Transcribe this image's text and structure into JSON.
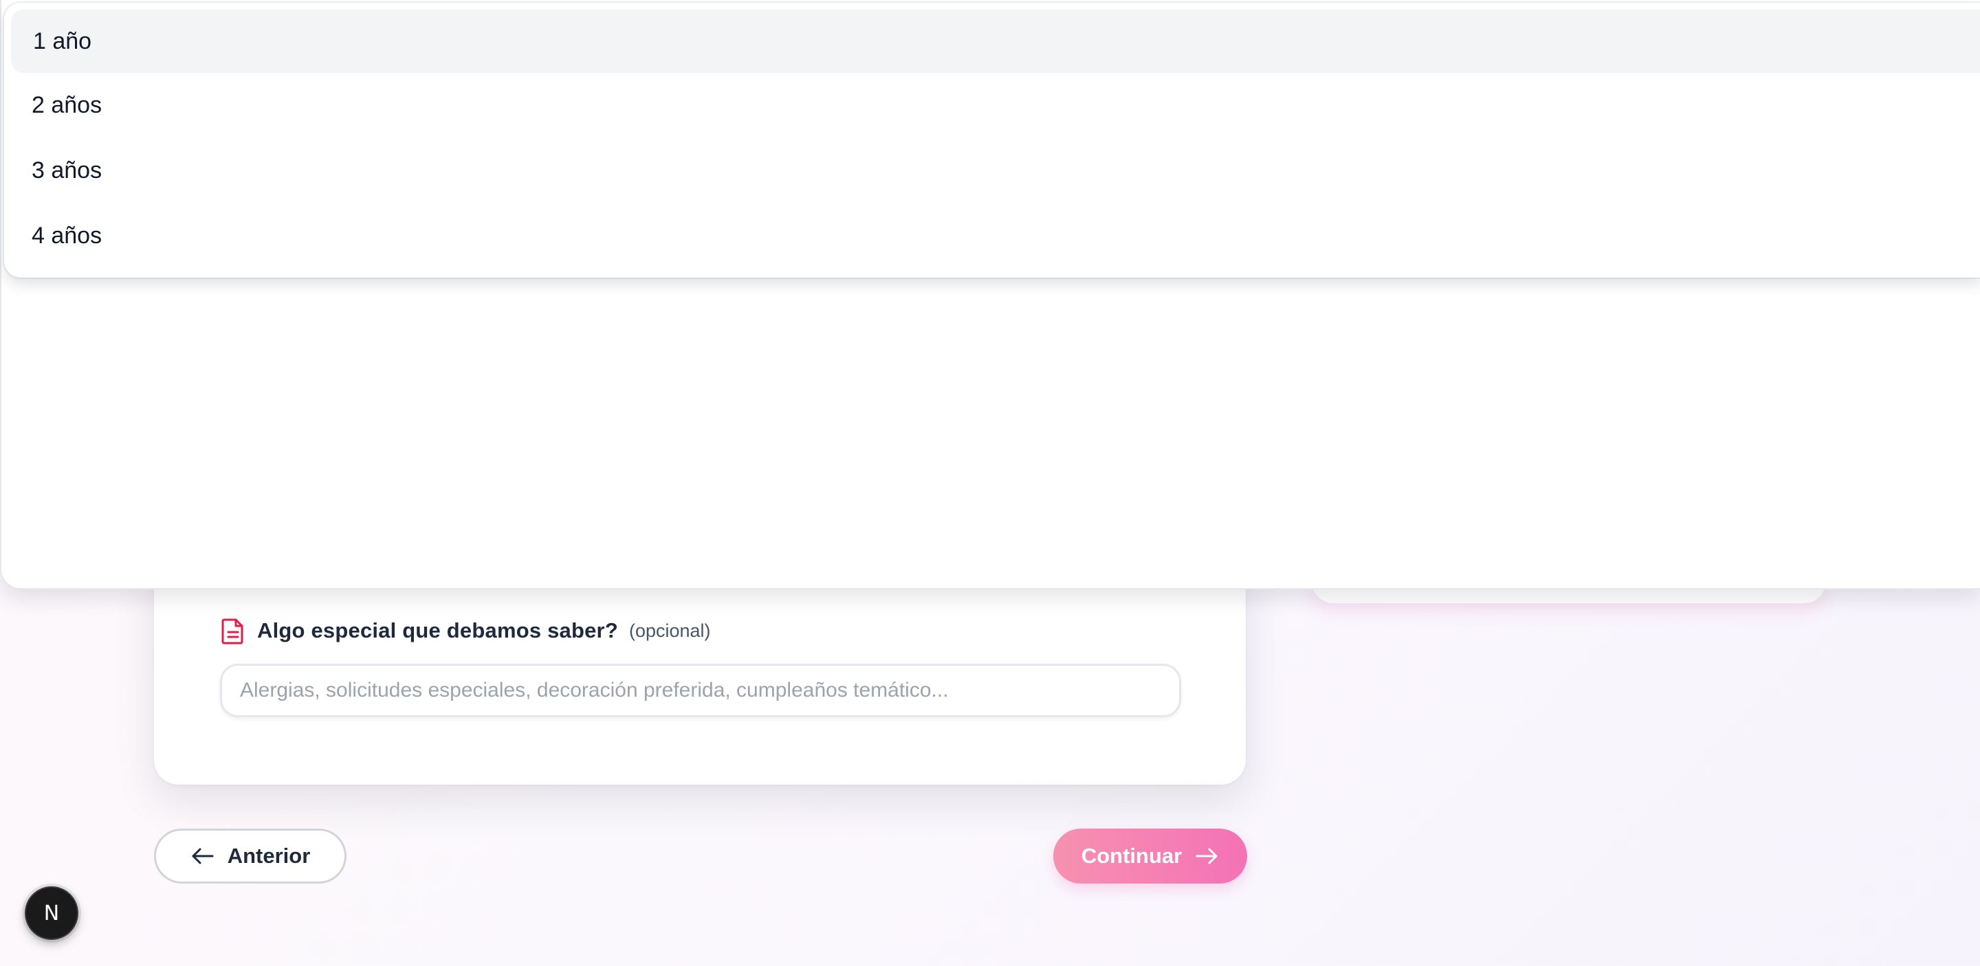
{
  "dropdown": {
    "options": [
      {
        "label": "1 año",
        "highlighted": true
      },
      {
        "label": "2 años",
        "highlighted": false
      },
      {
        "label": "3 años",
        "highlighted": false
      },
      {
        "label": "4 años",
        "highlighted": false
      }
    ]
  },
  "form": {
    "notes_field": {
      "icon": "document-icon",
      "label": "Algo especial que debamos saber?",
      "optional_tag": "(opcional)",
      "placeholder": "Alergias, solicitudes especiales, decoración preferida, cumpleaños temático...",
      "value": ""
    }
  },
  "navigation": {
    "previous_label": "Anterior",
    "previous_icon": "arrow-left-icon",
    "next_label": "Continuar",
    "next_icon": "arrow-right-icon"
  },
  "dev_badge": {
    "letter": "N",
    "icon": "nextjs-logo-icon"
  },
  "colors": {
    "accent_pink": "#f472b6",
    "icon_red": "#e11d48",
    "text_dark": "#1e293b",
    "placeholder": "#9ca3af"
  }
}
